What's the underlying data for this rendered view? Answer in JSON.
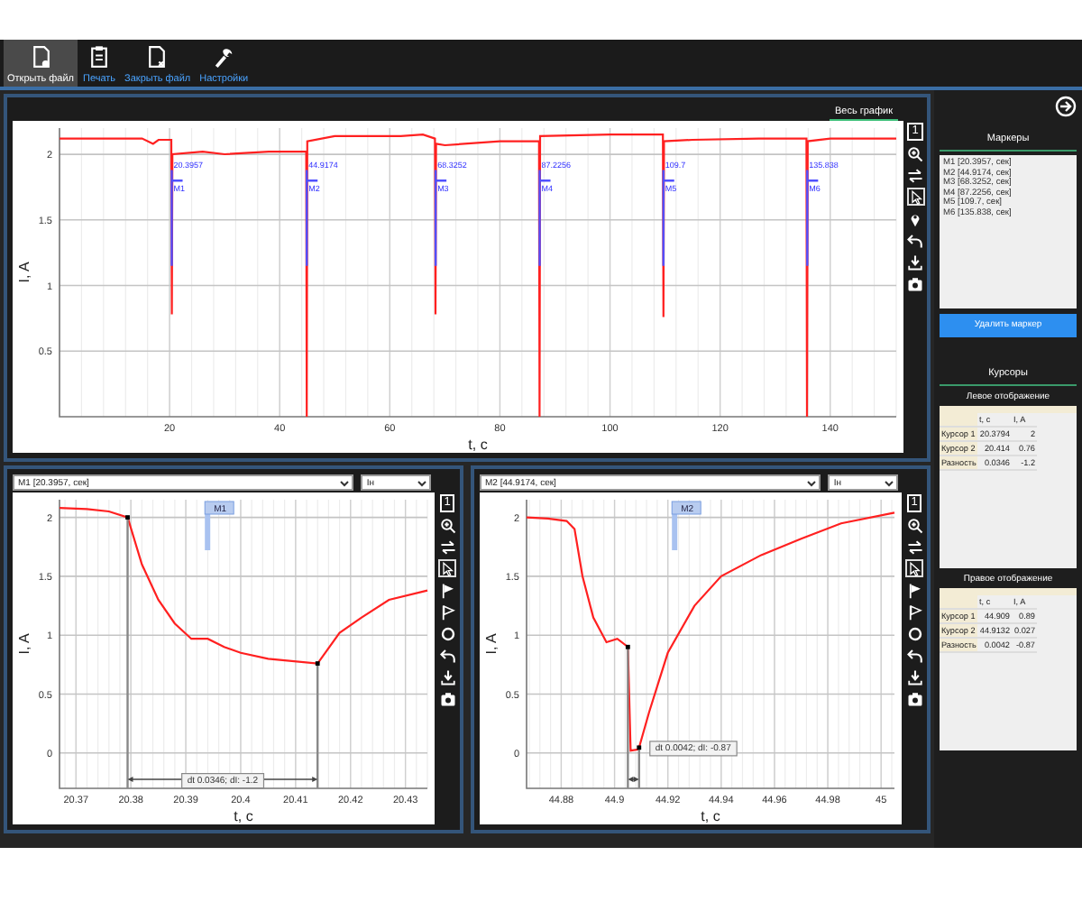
{
  "toolbar": [
    {
      "kind": "open",
      "label": "Открыть файл",
      "selected": true
    },
    {
      "kind": "print",
      "label": "Печать",
      "selected": false
    },
    {
      "kind": "close",
      "label": "Закрыть файл",
      "selected": false
    },
    {
      "kind": "settings",
      "label": "Настройки",
      "selected": false
    }
  ],
  "overview": {
    "tab": {
      "label": "Весь график",
      "selected": true
    },
    "tools": [
      {
        "kind": "one",
        "label": "1",
        "selected": false
      },
      {
        "kind": "zoom",
        "selected": false
      },
      {
        "kind": "swap",
        "selected": false
      },
      {
        "kind": "pointer",
        "selected": true
      },
      {
        "kind": "pin",
        "selected": false
      },
      {
        "kind": "undo",
        "selected": false
      },
      {
        "kind": "download",
        "selected": false
      },
      {
        "kind": "camera",
        "selected": false
      }
    ],
    "chart_data": {
      "type": "line",
      "xlabel": "t, c",
      "ylabel": "I, A",
      "x": [
        0,
        15,
        17,
        18,
        20.3,
        20.4,
        20.5,
        26,
        30,
        38,
        44.8,
        44.9,
        45,
        50,
        62,
        66,
        68.2,
        68.3,
        68.4,
        70,
        80,
        87.1,
        87.2,
        87.3,
        100,
        109.6,
        109.7,
        109.8,
        115,
        127,
        135.7,
        135.8,
        135.9,
        140,
        152
      ],
      "series": [
        {
          "color": "#ff2020",
          "values": [
            2.12,
            2.12,
            2.08,
            2.11,
            2.11,
            0.78,
            2.0,
            2.02,
            2.0,
            2.02,
            2.02,
            0.0,
            2.1,
            2.14,
            2.14,
            2.15,
            2.12,
            0.78,
            2.08,
            2.07,
            2.1,
            2.1,
            0.0,
            2.14,
            2.15,
            2.15,
            0.76,
            2.1,
            2.11,
            2.12,
            2.12,
            0.0,
            2.1,
            2.12,
            2.12
          ]
        }
      ],
      "xlim": [
        0,
        152
      ],
      "ylim": [
        0,
        2.2
      ],
      "xticks": [
        20,
        40,
        60,
        80,
        100,
        120,
        140
      ],
      "yticks": [
        0.5,
        1,
        1.5,
        2
      ],
      "grid": true,
      "ref_lines": [
        {
          "axis": "x",
          "value": 20.3957,
          "color": "#5050ff"
        },
        {
          "axis": "x",
          "value": 44.9174,
          "color": "#5050ff"
        },
        {
          "axis": "x",
          "value": 68.3252,
          "color": "#5050ff"
        },
        {
          "axis": "x",
          "value": 87.2256,
          "color": "#5050ff"
        },
        {
          "axis": "x",
          "value": 109.7,
          "color": "#5050ff"
        },
        {
          "axis": "x",
          "value": 135.838,
          "color": "#5050ff"
        }
      ],
      "annotations": [
        {
          "x": 20.3957,
          "y": 1.9,
          "text": "20.3957"
        },
        {
          "x": 20.3957,
          "y": 1.72,
          "text": "M1"
        },
        {
          "x": 44.9174,
          "y": 1.9,
          "text": "44.9174"
        },
        {
          "x": 44.9174,
          "y": 1.72,
          "text": "M2"
        },
        {
          "x": 68.3252,
          "y": 1.9,
          "text": "68.3252"
        },
        {
          "x": 68.3252,
          "y": 1.72,
          "text": "M3"
        },
        {
          "x": 87.2256,
          "y": 1.9,
          "text": "87.2256"
        },
        {
          "x": 87.2256,
          "y": 1.72,
          "text": "M4"
        },
        {
          "x": 109.7,
          "y": 1.9,
          "text": "109.7"
        },
        {
          "x": 109.7,
          "y": 1.72,
          "text": "M5"
        },
        {
          "x": 135.838,
          "y": 1.9,
          "text": "135.838"
        },
        {
          "x": 135.838,
          "y": 1.72,
          "text": "M6"
        }
      ]
    }
  },
  "detail_panels": [
    {
      "marker_select": "M1 [20.3957, сек]",
      "channel_select": "Iн",
      "tools": [
        {
          "kind": "one",
          "label": "1",
          "selected": false
        },
        {
          "kind": "zoom",
          "selected": false
        },
        {
          "kind": "swap",
          "selected": false
        },
        {
          "kind": "pointer",
          "selected": true
        },
        {
          "kind": "flag",
          "selected": false
        },
        {
          "kind": "flag-outline",
          "selected": false
        },
        {
          "kind": "circle",
          "selected": false
        },
        {
          "kind": "undo",
          "selected": false
        },
        {
          "kind": "download",
          "selected": false
        },
        {
          "kind": "camera",
          "selected": false
        }
      ],
      "chart_data": {
        "type": "line",
        "xlabel": "t, c",
        "ylabel": "I, A",
        "x": [
          20.367,
          20.372,
          20.376,
          20.3794,
          20.382,
          20.385,
          20.388,
          20.391,
          20.394,
          20.397,
          20.4,
          20.405,
          20.414,
          20.418,
          20.422,
          20.427,
          20.434
        ],
        "series": [
          {
            "color": "#ff2020",
            "values": [
              2.08,
              2.07,
              2.05,
              2.0,
              1.6,
              1.3,
              1.1,
              0.97,
              0.97,
              0.9,
              0.85,
              0.8,
              0.76,
              1.02,
              1.15,
              1.3,
              1.38
            ]
          }
        ],
        "xlim": [
          20.367,
          20.434
        ],
        "ylim": [
          -0.3,
          2.15
        ],
        "xticks": [
          20.37,
          20.38,
          20.39,
          20.4,
          20.41,
          20.42,
          20.43
        ],
        "yticks": [
          0,
          0.5,
          1,
          1.5,
          2
        ],
        "grid": true,
        "ref_lines": [
          {
            "axis": "x",
            "value": 20.3794,
            "color": "#888888"
          },
          {
            "axis": "x",
            "value": 20.414,
            "color": "#888888"
          }
        ],
        "annotations": [
          "M1"
        ]
      },
      "measure_label": "dt 0.0346; dI: -1.2"
    },
    {
      "marker_select": "M2 [44.9174, сек]",
      "channel_select": "Iн",
      "tools": [
        {
          "kind": "one",
          "label": "1",
          "selected": false
        },
        {
          "kind": "zoom",
          "selected": false
        },
        {
          "kind": "swap",
          "selected": false
        },
        {
          "kind": "pointer",
          "selected": true
        },
        {
          "kind": "flag",
          "selected": false
        },
        {
          "kind": "flag-outline",
          "selected": false
        },
        {
          "kind": "circle",
          "selected": false
        },
        {
          "kind": "undo",
          "selected": false
        },
        {
          "kind": "download",
          "selected": false
        },
        {
          "kind": "camera",
          "selected": false
        }
      ],
      "chart_data": {
        "type": "line",
        "xlabel": "t, c",
        "ylabel": "I, A",
        "x": [
          44.867,
          44.875,
          44.882,
          44.885,
          44.888,
          44.892,
          44.897,
          44.901,
          44.905,
          44.906,
          44.909,
          44.913,
          44.92,
          44.93,
          44.94,
          44.955,
          44.97,
          44.985,
          45.005
        ],
        "series": [
          {
            "color": "#ff2020",
            "values": [
              2.0,
              1.99,
              1.97,
              1.9,
              1.5,
              1.15,
              0.94,
              0.97,
              0.9,
              0.02,
              0.03,
              0.35,
              0.85,
              1.25,
              1.5,
              1.68,
              1.82,
              1.95,
              2.04
            ]
          }
        ],
        "xlim": [
          44.867,
          45.005
        ],
        "ylim": [
          -0.3,
          2.15
        ],
        "xticks": [
          44.88,
          44.9,
          44.92,
          44.94,
          44.96,
          44.98,
          45
        ],
        "yticks": [
          0,
          0.5,
          1,
          1.5,
          2
        ],
        "grid": true,
        "ref_lines": [
          {
            "axis": "x",
            "value": 44.905,
            "color": "#888888"
          },
          {
            "axis": "x",
            "value": 44.9092,
            "color": "#888888"
          }
        ],
        "annotations": [
          "M2"
        ]
      },
      "measure_label": "dt 0.0042; dI: -0.87"
    }
  ],
  "sidebar": {
    "markers_title": "Маркеры",
    "markers": [
      "M1 [20.3957, сек]",
      "M2 [44.9174, сек]",
      "M3 [68.3252, сек]",
      "M4 [87.2256, сек]",
      "M5 [109.7, сек]",
      "M6 [135.838, сек]"
    ],
    "delete_button": "Удалить маркер",
    "cursors_title": "Курсоры",
    "tables": [
      {
        "title": "Левое отображение",
        "columns": [
          "t, c",
          "I, A"
        ],
        "rows": [
          {
            "label": "Курсор 1",
            "t": "20.3794",
            "i": "2"
          },
          {
            "label": "Курсор 2",
            "t": "20.414",
            "i": "0.76"
          },
          {
            "label": "Разность",
            "t": "0.0346",
            "i": "-1.2"
          }
        ]
      },
      {
        "title": "Правое отображение",
        "columns": [
          "t, c",
          "I, A"
        ],
        "rows": [
          {
            "label": "Курсор 1",
            "t": "44.909",
            "i": "0.89"
          },
          {
            "label": "Курсор 2",
            "t": "44.9132",
            "i": "0.027"
          },
          {
            "label": "Разность",
            "t": "0.0042",
            "i": "-0.87"
          }
        ]
      }
    ]
  }
}
